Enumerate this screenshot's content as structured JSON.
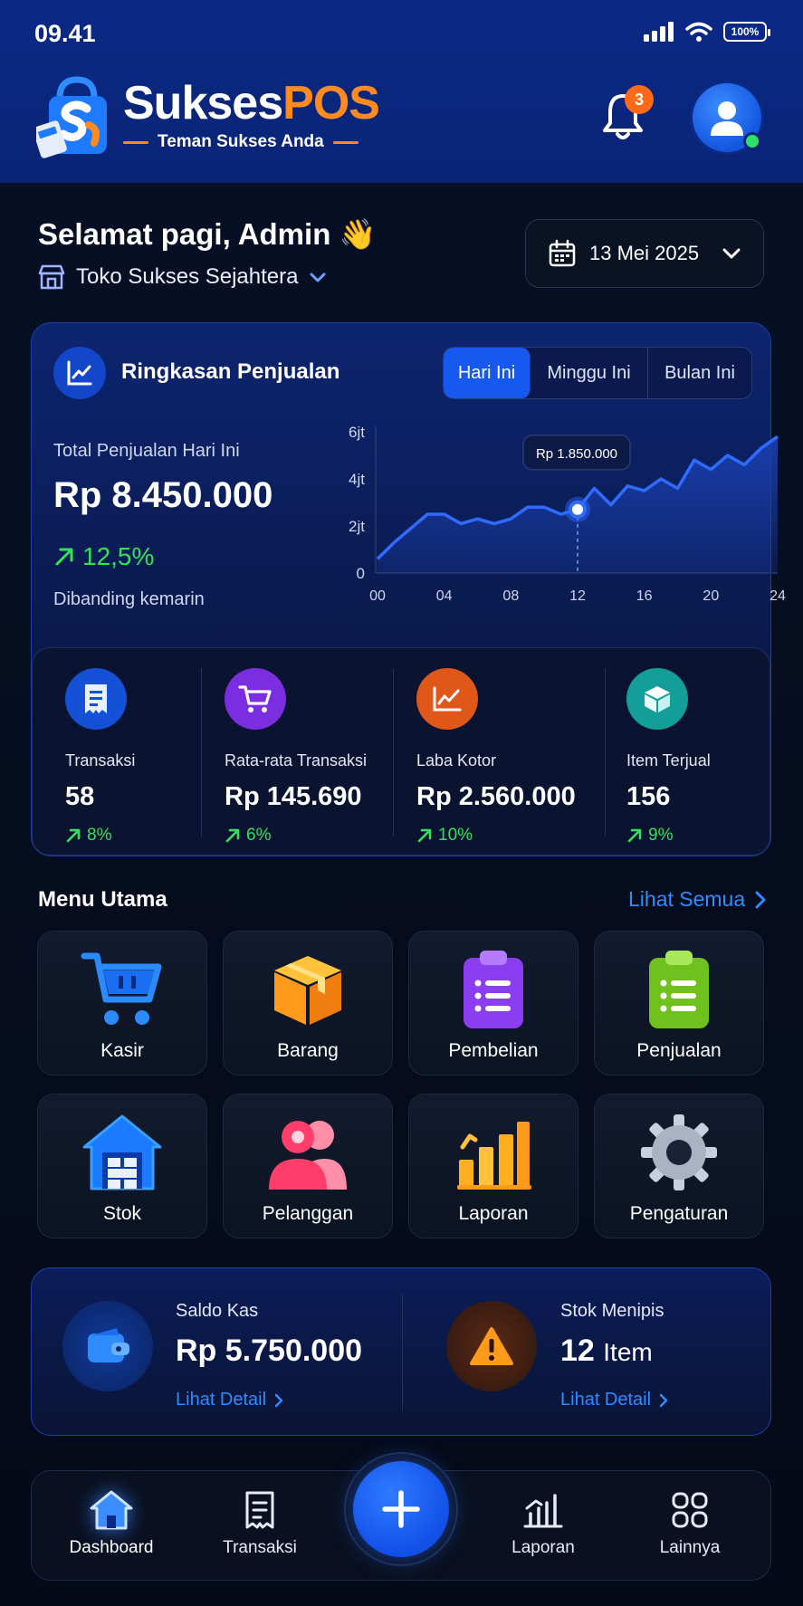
{
  "status_bar": {
    "time": "09.41",
    "battery": "100%"
  },
  "brand": {
    "name_part1": "Sukses",
    "name_part2": "POS",
    "tagline": "Teman Sukses Anda"
  },
  "header": {
    "notification_count": "3"
  },
  "greeting": {
    "text": "Selamat pagi, Admin 👋",
    "store": "Toko Sukses Sejahtera",
    "date": "13 Mei 2025"
  },
  "summary": {
    "title": "Ringkasan Penjualan",
    "tabs": [
      {
        "label": "Hari Ini",
        "active": true
      },
      {
        "label": "Minggu Ini",
        "active": false
      },
      {
        "label": "Bulan Ini",
        "active": false
      }
    ],
    "total_label": "Total Penjualan Hari Ini",
    "total_value": "Rp 8.450.000",
    "change": "12,5%",
    "change_note": "Dibanding kemarin"
  },
  "chart_data": {
    "type": "area",
    "x_ticks": [
      "00",
      "04",
      "08",
      "12",
      "16",
      "20",
      "24"
    ],
    "y_ticks": [
      "0",
      "2jt",
      "4jt",
      "6jt"
    ],
    "ylim": [
      0,
      6
    ],
    "x": [
      0,
      1,
      2,
      3,
      4,
      5,
      6,
      7,
      8,
      9,
      10,
      11,
      12,
      13,
      14,
      15,
      16,
      17,
      18,
      19,
      20,
      21,
      22,
      23,
      24
    ],
    "values": [
      0.6,
      1.3,
      1.9,
      2.5,
      2.5,
      2.1,
      2.3,
      2.1,
      2.3,
      2.8,
      2.8,
      2.5,
      2.7,
      3.6,
      2.9,
      3.7,
      3.5,
      4.0,
      3.6,
      4.8,
      4.4,
      5.0,
      4.6,
      5.3,
      5.8
    ],
    "highlight": {
      "x": 12,
      "value": 2.7,
      "label": "Rp 1.850.000"
    },
    "grid": false,
    "colors": {
      "line": "#2f6bff",
      "fill": "#1a3fae"
    }
  },
  "stats": [
    {
      "label": "Transaksi",
      "value": "58",
      "change": "8%",
      "icon": "receipt-icon",
      "color": "#1551d6"
    },
    {
      "label": "Rata-rata Transaksi",
      "value": "Rp 145.690",
      "change": "6%",
      "icon": "cart-icon",
      "color": "#7a2ee0"
    },
    {
      "label": "Laba Kotor",
      "value": "Rp 2.560.000",
      "change": "10%",
      "icon": "chart-line-icon",
      "color": "#e0571a"
    },
    {
      "label": "Item Terjual",
      "value": "156",
      "change": "9%",
      "icon": "box-icon",
      "color": "#139e9a"
    }
  ],
  "menu": {
    "title": "Menu Utama",
    "see_all": "Lihat Semua",
    "items": [
      {
        "label": "Kasir",
        "icon": "shopping-cart-icon"
      },
      {
        "label": "Barang",
        "icon": "package-icon"
      },
      {
        "label": "Pembelian",
        "icon": "clipboard-purple-icon"
      },
      {
        "label": "Penjualan",
        "icon": "clipboard-green-icon"
      },
      {
        "label": "Stok",
        "icon": "warehouse-icon"
      },
      {
        "label": "Pelanggan",
        "icon": "customers-icon"
      },
      {
        "label": "Laporan",
        "icon": "bar-chart-icon"
      },
      {
        "label": "Pengaturan",
        "icon": "gear-icon"
      }
    ]
  },
  "info": {
    "cash": {
      "label": "Saldo Kas",
      "value": "Rp 5.750.000",
      "link": "Lihat Detail"
    },
    "low_stock": {
      "label": "Stok Menipis",
      "value_number": "12",
      "value_unit": "Item",
      "link": "Lihat Detail"
    }
  },
  "bottom_nav": [
    {
      "label": "Dashboard",
      "icon": "home-icon",
      "active": true
    },
    {
      "label": "Transaksi",
      "icon": "receipt-icon",
      "active": false
    },
    {
      "label": "Laporan",
      "icon": "bar-chart-icon",
      "active": false
    },
    {
      "label": "Lainnya",
      "icon": "grid-icon",
      "active": false
    }
  ]
}
